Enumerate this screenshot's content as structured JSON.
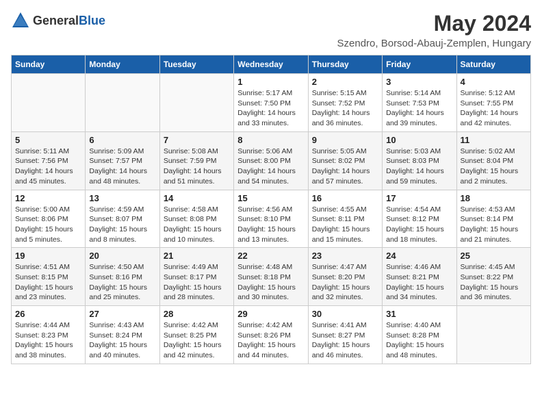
{
  "header": {
    "logo_general": "General",
    "logo_blue": "Blue",
    "main_title": "May 2024",
    "subtitle": "Szendro, Borsod-Abauj-Zemplen, Hungary"
  },
  "calendar": {
    "days_of_week": [
      "Sunday",
      "Monday",
      "Tuesday",
      "Wednesday",
      "Thursday",
      "Friday",
      "Saturday"
    ],
    "weeks": [
      [
        {
          "day": "",
          "sunrise": "",
          "sunset": "",
          "daylight": ""
        },
        {
          "day": "",
          "sunrise": "",
          "sunset": "",
          "daylight": ""
        },
        {
          "day": "",
          "sunrise": "",
          "sunset": "",
          "daylight": ""
        },
        {
          "day": "1",
          "sunrise": "Sunrise: 5:17 AM",
          "sunset": "Sunset: 7:50 PM",
          "daylight": "Daylight: 14 hours and 33 minutes."
        },
        {
          "day": "2",
          "sunrise": "Sunrise: 5:15 AM",
          "sunset": "Sunset: 7:52 PM",
          "daylight": "Daylight: 14 hours and 36 minutes."
        },
        {
          "day": "3",
          "sunrise": "Sunrise: 5:14 AM",
          "sunset": "Sunset: 7:53 PM",
          "daylight": "Daylight: 14 hours and 39 minutes."
        },
        {
          "day": "4",
          "sunrise": "Sunrise: 5:12 AM",
          "sunset": "Sunset: 7:55 PM",
          "daylight": "Daylight: 14 hours and 42 minutes."
        }
      ],
      [
        {
          "day": "5",
          "sunrise": "Sunrise: 5:11 AM",
          "sunset": "Sunset: 7:56 PM",
          "daylight": "Daylight: 14 hours and 45 minutes."
        },
        {
          "day": "6",
          "sunrise": "Sunrise: 5:09 AM",
          "sunset": "Sunset: 7:57 PM",
          "daylight": "Daylight: 14 hours and 48 minutes."
        },
        {
          "day": "7",
          "sunrise": "Sunrise: 5:08 AM",
          "sunset": "Sunset: 7:59 PM",
          "daylight": "Daylight: 14 hours and 51 minutes."
        },
        {
          "day": "8",
          "sunrise": "Sunrise: 5:06 AM",
          "sunset": "Sunset: 8:00 PM",
          "daylight": "Daylight: 14 hours and 54 minutes."
        },
        {
          "day": "9",
          "sunrise": "Sunrise: 5:05 AM",
          "sunset": "Sunset: 8:02 PM",
          "daylight": "Daylight: 14 hours and 57 minutes."
        },
        {
          "day": "10",
          "sunrise": "Sunrise: 5:03 AM",
          "sunset": "Sunset: 8:03 PM",
          "daylight": "Daylight: 14 hours and 59 minutes."
        },
        {
          "day": "11",
          "sunrise": "Sunrise: 5:02 AM",
          "sunset": "Sunset: 8:04 PM",
          "daylight": "Daylight: 15 hours and 2 minutes."
        }
      ],
      [
        {
          "day": "12",
          "sunrise": "Sunrise: 5:00 AM",
          "sunset": "Sunset: 8:06 PM",
          "daylight": "Daylight: 15 hours and 5 minutes."
        },
        {
          "day": "13",
          "sunrise": "Sunrise: 4:59 AM",
          "sunset": "Sunset: 8:07 PM",
          "daylight": "Daylight: 15 hours and 8 minutes."
        },
        {
          "day": "14",
          "sunrise": "Sunrise: 4:58 AM",
          "sunset": "Sunset: 8:08 PM",
          "daylight": "Daylight: 15 hours and 10 minutes."
        },
        {
          "day": "15",
          "sunrise": "Sunrise: 4:56 AM",
          "sunset": "Sunset: 8:10 PM",
          "daylight": "Daylight: 15 hours and 13 minutes."
        },
        {
          "day": "16",
          "sunrise": "Sunrise: 4:55 AM",
          "sunset": "Sunset: 8:11 PM",
          "daylight": "Daylight: 15 hours and 15 minutes."
        },
        {
          "day": "17",
          "sunrise": "Sunrise: 4:54 AM",
          "sunset": "Sunset: 8:12 PM",
          "daylight": "Daylight: 15 hours and 18 minutes."
        },
        {
          "day": "18",
          "sunrise": "Sunrise: 4:53 AM",
          "sunset": "Sunset: 8:14 PM",
          "daylight": "Daylight: 15 hours and 21 minutes."
        }
      ],
      [
        {
          "day": "19",
          "sunrise": "Sunrise: 4:51 AM",
          "sunset": "Sunset: 8:15 PM",
          "daylight": "Daylight: 15 hours and 23 minutes."
        },
        {
          "day": "20",
          "sunrise": "Sunrise: 4:50 AM",
          "sunset": "Sunset: 8:16 PM",
          "daylight": "Daylight: 15 hours and 25 minutes."
        },
        {
          "day": "21",
          "sunrise": "Sunrise: 4:49 AM",
          "sunset": "Sunset: 8:17 PM",
          "daylight": "Daylight: 15 hours and 28 minutes."
        },
        {
          "day": "22",
          "sunrise": "Sunrise: 4:48 AM",
          "sunset": "Sunset: 8:18 PM",
          "daylight": "Daylight: 15 hours and 30 minutes."
        },
        {
          "day": "23",
          "sunrise": "Sunrise: 4:47 AM",
          "sunset": "Sunset: 8:20 PM",
          "daylight": "Daylight: 15 hours and 32 minutes."
        },
        {
          "day": "24",
          "sunrise": "Sunrise: 4:46 AM",
          "sunset": "Sunset: 8:21 PM",
          "daylight": "Daylight: 15 hours and 34 minutes."
        },
        {
          "day": "25",
          "sunrise": "Sunrise: 4:45 AM",
          "sunset": "Sunset: 8:22 PM",
          "daylight": "Daylight: 15 hours and 36 minutes."
        }
      ],
      [
        {
          "day": "26",
          "sunrise": "Sunrise: 4:44 AM",
          "sunset": "Sunset: 8:23 PM",
          "daylight": "Daylight: 15 hours and 38 minutes."
        },
        {
          "day": "27",
          "sunrise": "Sunrise: 4:43 AM",
          "sunset": "Sunset: 8:24 PM",
          "daylight": "Daylight: 15 hours and 40 minutes."
        },
        {
          "day": "28",
          "sunrise": "Sunrise: 4:42 AM",
          "sunset": "Sunset: 8:25 PM",
          "daylight": "Daylight: 15 hours and 42 minutes."
        },
        {
          "day": "29",
          "sunrise": "Sunrise: 4:42 AM",
          "sunset": "Sunset: 8:26 PM",
          "daylight": "Daylight: 15 hours and 44 minutes."
        },
        {
          "day": "30",
          "sunrise": "Sunrise: 4:41 AM",
          "sunset": "Sunset: 8:27 PM",
          "daylight": "Daylight: 15 hours and 46 minutes."
        },
        {
          "day": "31",
          "sunrise": "Sunrise: 4:40 AM",
          "sunset": "Sunset: 8:28 PM",
          "daylight": "Daylight: 15 hours and 48 minutes."
        },
        {
          "day": "",
          "sunrise": "",
          "sunset": "",
          "daylight": ""
        }
      ]
    ]
  }
}
